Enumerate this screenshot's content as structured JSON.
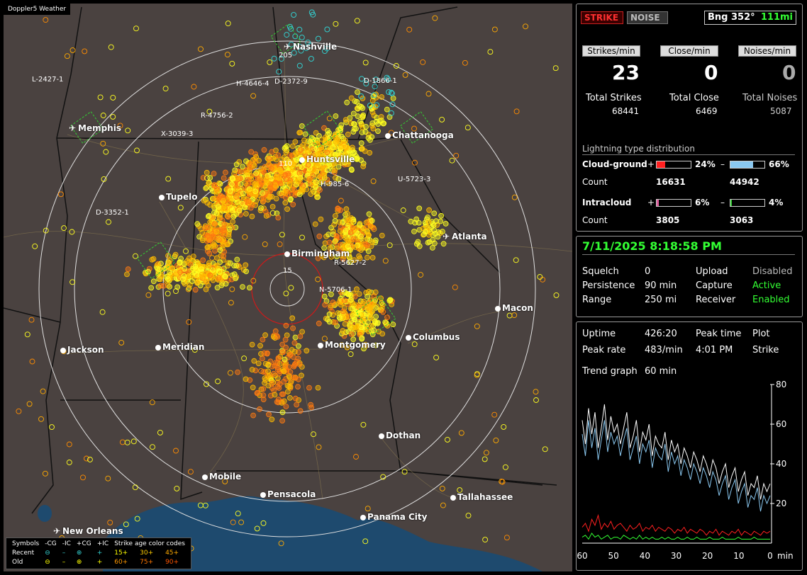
{
  "app": {
    "title": "Doppler5 Weather"
  },
  "colors": {
    "map_bg": "#4a4240",
    "water": "#1e4a6e",
    "strike_recent": "#ffff00",
    "strike_old": "#ff8c00",
    "green": "#33ff33",
    "red": "#ff2020",
    "cg_neg_bar": "#8ac8f0",
    "ic_pos_bar": "#e060a0"
  },
  "map": {
    "cities": [
      {
        "name": "Nashville",
        "icon": "airport-icon"
      },
      {
        "name": "Memphis",
        "icon": "airport-icon"
      },
      {
        "name": "Chattanooga",
        "icon": "dot-icon"
      },
      {
        "name": "Huntsville",
        "icon": "dot-icon"
      },
      {
        "name": "Tupelo",
        "icon": "dot-icon"
      },
      {
        "name": "Birmingham",
        "icon": "dot-icon"
      },
      {
        "name": "Atlanta",
        "icon": "airport-icon"
      },
      {
        "name": "Macon",
        "icon": "dot-icon"
      },
      {
        "name": "Columbus",
        "icon": "dot-icon"
      },
      {
        "name": "Montgomery",
        "icon": "dot-icon"
      },
      {
        "name": "Meridian",
        "icon": "dot-icon"
      },
      {
        "name": "Jackson",
        "icon": "dot-icon"
      },
      {
        "name": "Dothan",
        "icon": "dot-icon"
      },
      {
        "name": "Mobile",
        "icon": "dot-icon"
      },
      {
        "name": "Pensacola",
        "icon": "dot-icon"
      },
      {
        "name": "Tallahassee",
        "icon": "dot-icon"
      },
      {
        "name": "Panama City",
        "icon": "dot-icon"
      },
      {
        "name": "New Orleans",
        "icon": "airport-icon"
      }
    ],
    "cell_labels": [
      "L-2427-1",
      "H-4646-4",
      "D-2372-9",
      "D-1866-1",
      "R-4756-2",
      "X-3039-3",
      "D-3352-1",
      "H-985-6",
      "U-5723-3",
      "R-5627-2",
      "N-5706-1",
      "205",
      "110",
      "15"
    ],
    "legend": {
      "header": [
        "Symbols",
        "-CG",
        "-IC",
        "+CG",
        "+IC",
        "Strike age color codes"
      ],
      "recent": {
        "label": "Recent",
        "ages": [
          "15+",
          "30+",
          "45+"
        ]
      },
      "old": {
        "label": "Old",
        "ages": [
          "60+",
          "75+",
          "90+"
        ]
      }
    }
  },
  "status": {
    "strike_button": "STRIKE",
    "noise_button": "NOISE",
    "bearing": "Bng 352°",
    "bearing_range": "111mi",
    "rates": [
      {
        "header": "Strikes/min",
        "value": "23",
        "total_label": "Total Strikes",
        "total": "68441"
      },
      {
        "header": "Close/min",
        "value": "0",
        "total_label": "Total Close",
        "total": "6469"
      },
      {
        "header": "Noises/min",
        "value": "0",
        "total_label": "Total Noises",
        "total": "5087"
      }
    ],
    "distribution": {
      "title": "Lightning type distribution",
      "cg_label": "Cloud-ground",
      "cg_pos_pct": "24%",
      "cg_pos_frac": 0.24,
      "cg_neg_pct": "66%",
      "cg_neg_frac": 0.66,
      "cg_count_label": "Count",
      "cg_pos_count": "16631",
      "cg_neg_count": "44942",
      "ic_label": "Intracloud",
      "ic_pos_pct": "6%",
      "ic_pos_frac": 0.06,
      "ic_neg_pct": "4%",
      "ic_neg_frac": 0.04,
      "ic_count_label": "Count",
      "ic_pos_count": "3805",
      "ic_neg_count": "3063",
      "plus": "+",
      "minus": "–"
    }
  },
  "settings": {
    "datetime": "7/11/2025 8:18:58 PM",
    "rows": [
      {
        "k1": "Squelch",
        "v1": "0",
        "k2": "Upload",
        "v2": "Disabled"
      },
      {
        "k1": "Persistence",
        "v1": "90 min",
        "k2": "Capture",
        "v2": "Active"
      },
      {
        "k1": "Range",
        "v1": "250 mi",
        "k2": "Receiver",
        "v2": "Enabled"
      }
    ]
  },
  "stats": {
    "uptime_label": "Uptime",
    "uptime": "426:20",
    "peak_time_label": "Peak time",
    "peak_time": "4:01 PM",
    "plot_label": "Plot",
    "plot": "Strike",
    "peak_rate_label": "Peak rate",
    "peak_rate": "483/min",
    "trend_label": "Trend graph",
    "trend": "60 min"
  },
  "chart_data": {
    "type": "line",
    "x_ticks": [
      "60",
      "50",
      "40",
      "30",
      "20",
      "10",
      "0"
    ],
    "x_unit": "min",
    "y_ticks": [
      "80",
      "60",
      "40",
      "20"
    ],
    "ylim": [
      0,
      80
    ],
    "xlim": [
      60,
      0
    ],
    "series": [
      {
        "color": "#ffffff",
        "values": [
          62,
          50,
          68,
          55,
          66,
          48,
          58,
          70,
          52,
          64,
          56,
          60,
          50,
          58,
          66,
          48,
          54,
          62,
          46,
          56,
          52,
          60,
          44,
          54,
          50,
          48,
          56,
          42,
          52,
          46,
          50,
          40,
          48,
          44,
          38,
          46,
          42,
          36,
          44,
          40,
          34,
          42,
          38,
          30,
          36,
          40,
          28,
          34,
          38,
          26,
          32,
          36,
          24,
          30,
          28,
          34,
          22,
          30,
          26,
          30
        ]
      },
      {
        "color": "#8ac8f0",
        "values": [
          55,
          44,
          62,
          48,
          58,
          42,
          52,
          62,
          46,
          56,
          50,
          54,
          44,
          52,
          58,
          42,
          48,
          54,
          40,
          50,
          46,
          52,
          38,
          48,
          44,
          42,
          50,
          36,
          46,
          40,
          44,
          34,
          42,
          38,
          32,
          40,
          36,
          30,
          38,
          34,
          28,
          36,
          32,
          24,
          30,
          34,
          22,
          28,
          32,
          20,
          26,
          30,
          18,
          24,
          22,
          28,
          16,
          24,
          20,
          24
        ]
      },
      {
        "color": "#ff2020",
        "values": [
          8,
          10,
          6,
          12,
          9,
          14,
          7,
          10,
          8,
          11,
          7,
          9,
          10,
          8,
          6,
          9,
          7,
          8,
          10,
          6,
          8,
          7,
          9,
          6,
          8,
          7,
          6,
          8,
          7,
          5,
          7,
          6,
          8,
          5,
          7,
          6,
          5,
          7,
          6,
          4,
          6,
          5,
          7,
          4,
          6,
          5,
          4,
          6,
          5,
          7,
          4,
          6,
          5,
          4,
          6,
          5,
          4,
          6,
          5,
          6
        ]
      },
      {
        "color": "#33ff33",
        "values": [
          3,
          4,
          2,
          5,
          3,
          4,
          2,
          3,
          4,
          2,
          3,
          3,
          2,
          4,
          3,
          2,
          3,
          2,
          4,
          2,
          3,
          2,
          3,
          2,
          2,
          3,
          2,
          3,
          2,
          2,
          3,
          2,
          2,
          3,
          2,
          2,
          3,
          2,
          2,
          2,
          3,
          2,
          2,
          2,
          3,
          2,
          2,
          2,
          2,
          3,
          2,
          2,
          2,
          2,
          3,
          2,
          2,
          2,
          2,
          2
        ]
      }
    ]
  }
}
